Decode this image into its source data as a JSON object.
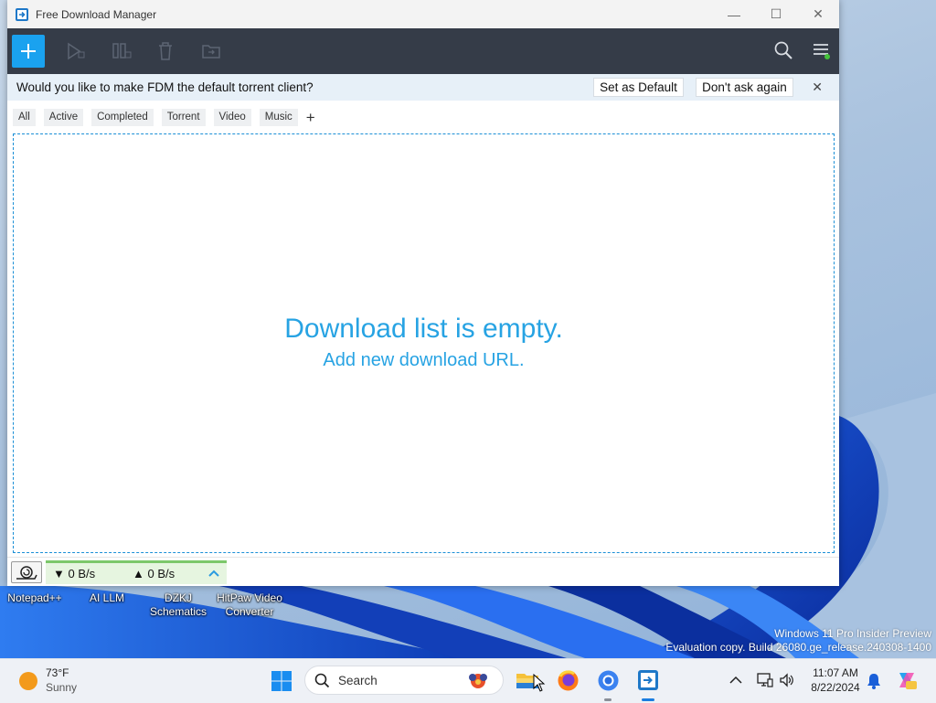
{
  "window": {
    "title": "Free Download Manager",
    "controls": [
      "—",
      "☐",
      "✕"
    ]
  },
  "notice": {
    "text": "Would you like to make FDM the default torrent client?",
    "set_default": "Set as Default",
    "dont_ask": "Don't ask again",
    "close": "✕"
  },
  "filters": {
    "items": [
      "All",
      "Active",
      "Completed",
      "Torrent",
      "Video",
      "Music"
    ],
    "add": "+"
  },
  "empty": {
    "line1": "Download list is empty.",
    "line2": "Add new download URL."
  },
  "status": {
    "down": "▼ 0 B/s",
    "up": "▲ 0 B/s",
    "expand": "^"
  },
  "desktop": {
    "icons": [
      "Notepad++",
      "AI LLM",
      "DZKJ\nSchematics",
      "HitPaw Video\nConverter"
    ],
    "watermark_line1": "Windows 11 Pro Insider Preview",
    "watermark_line2": "Evaluation copy. Build 26080.ge_release.240308-1400"
  },
  "taskbar": {
    "weather_temp": "73°F",
    "weather_cond": "Sunny",
    "search_placeholder": "Search",
    "time": "11:07 AM",
    "date": "8/22/2024"
  },
  "colors": {
    "accent": "#1aa2ef",
    "toolbar_bg": "#353c48",
    "empty_text": "#27a3e3"
  }
}
